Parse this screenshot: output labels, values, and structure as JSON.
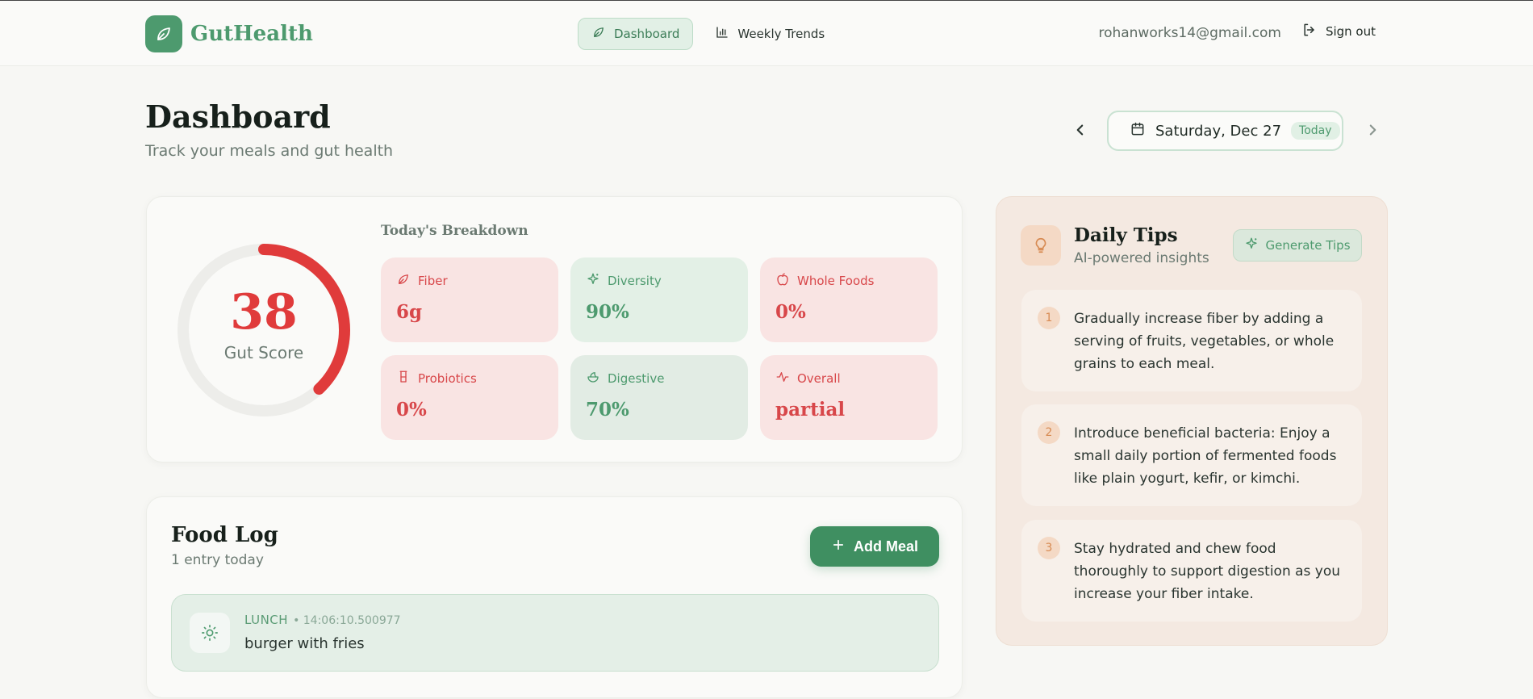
{
  "brand": {
    "name": "GutHealth"
  },
  "nav": {
    "tabs": [
      {
        "label": "Dashboard",
        "icon": "leaf-icon",
        "active": true
      },
      {
        "label": "Weekly Trends",
        "icon": "bar-chart-icon",
        "active": false
      }
    ]
  },
  "user": {
    "email": "rohanworks14@gmail.com",
    "signout_label": "Sign out"
  },
  "page": {
    "title": "Dashboard",
    "subtitle": "Track your meals and gut health"
  },
  "date_picker": {
    "label": "Saturday, Dec 27",
    "badge": "Today"
  },
  "score": {
    "value": "38",
    "label": "Gut Score",
    "fraction": 0.38,
    "color": "#e03b3b"
  },
  "breakdown": {
    "title": "Today's Breakdown",
    "tiles": [
      {
        "label": "Fiber",
        "value": "6g",
        "tone": "red",
        "icon": "leaf-icon"
      },
      {
        "label": "Diversity",
        "value": "90%",
        "tone": "green",
        "icon": "sparkle-icon"
      },
      {
        "label": "Whole Foods",
        "value": "0%",
        "tone": "red",
        "icon": "apple-icon"
      },
      {
        "label": "Probiotics",
        "value": "0%",
        "tone": "red",
        "icon": "cup-icon"
      },
      {
        "label": "Digestive",
        "value": "70%",
        "tone": "green2",
        "icon": "salad-icon"
      },
      {
        "label": "Overall",
        "value": "partial",
        "tone": "red",
        "icon": "activity-icon"
      }
    ]
  },
  "food_log": {
    "title": "Food Log",
    "subtitle": "1 entry today",
    "add_label": "Add Meal",
    "entries": [
      {
        "type": "LUNCH",
        "time": "• 14:06:10.500977",
        "name": "burger with fries",
        "icon": "sun-icon"
      }
    ]
  },
  "tips": {
    "title": "Daily Tips",
    "subtitle": "AI-powered insights",
    "generate_label": "Generate Tips",
    "items": [
      {
        "num": "1",
        "text": "Gradually increase fiber by adding a serving of fruits, vegetables, or whole grains to each meal."
      },
      {
        "num": "2",
        "text": "Introduce beneficial bacteria: Enjoy a small daily portion of fermented foods like plain yogurt, kefir, or kimchi."
      },
      {
        "num": "3",
        "text": "Stay hydrated and chew food thoroughly to support digestion as you increase your fiber intake."
      }
    ]
  },
  "colors": {
    "brand_green": "#4d9a6e",
    "alert_red": "#e03b3b",
    "tips_bg": "#f4e9e1"
  }
}
